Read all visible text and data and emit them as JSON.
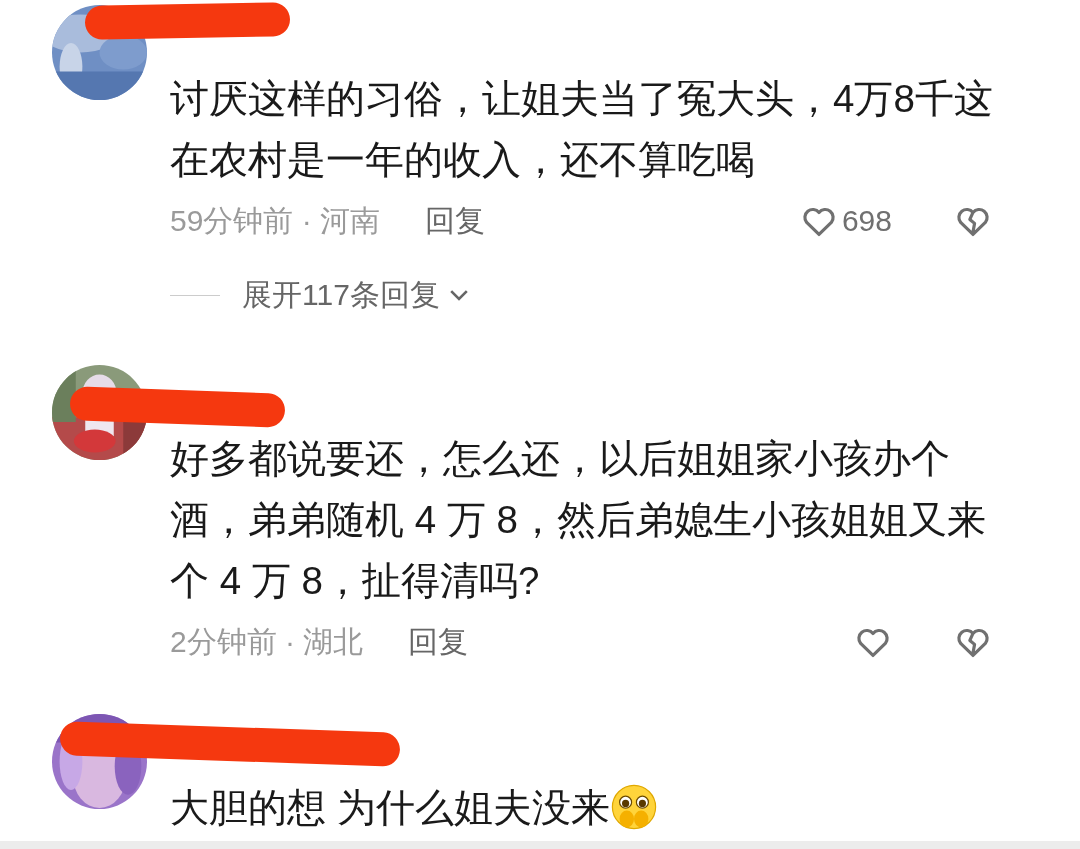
{
  "comments": [
    {
      "lines": [
        "讨厌这样的习俗，让姐夫当了冤大头，4万8千这",
        "在农村是一年的收入，还不算吃喝"
      ],
      "meta": "59分钟前 · 河南",
      "reply": "回复",
      "likes": "698",
      "expand": "展开117条回复"
    },
    {
      "lines": [
        "好多都说要还，怎么还，以后姐姐家小孩办个",
        "酒，弟弟随机 4 万 8，然后弟媳生小孩姐姐又来",
        "个 4 万 8，扯得清吗?"
      ],
      "meta": "2分钟前 · 湖北",
      "reply": "回复"
    },
    {
      "lines": [
        "大胆的想 为什么姐夫没来"
      ],
      "emoji": true
    }
  ]
}
